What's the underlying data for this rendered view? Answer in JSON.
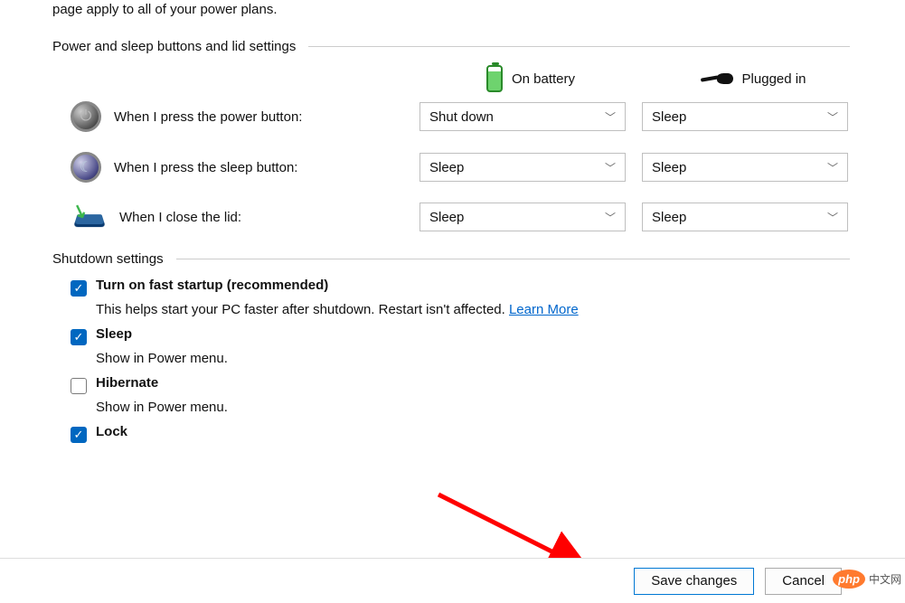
{
  "intro": "page apply to all of your power plans.",
  "sections": {
    "buttons": {
      "title": "Power and sleep buttons and lid settings",
      "columns": {
        "battery": "On battery",
        "plugged": "Plugged in"
      },
      "rows": {
        "power": {
          "label": "When I press the power button:",
          "battery": "Shut down",
          "plugged": "Sleep"
        },
        "sleep": {
          "label": "When I press the sleep button:",
          "battery": "Sleep",
          "plugged": "Sleep"
        },
        "lid": {
          "label": "When I close the lid:",
          "battery": "Sleep",
          "plugged": "Sleep"
        }
      }
    },
    "shutdown": {
      "title": "Shutdown settings",
      "items": {
        "fast": {
          "checked": true,
          "label": "Turn on fast startup (recommended)",
          "desc": "This helps start your PC faster after shutdown. Restart isn't affected.",
          "learn": "Learn More"
        },
        "sleep": {
          "checked": true,
          "label": "Sleep",
          "desc": "Show in Power menu."
        },
        "hibernate": {
          "checked": false,
          "label": "Hibernate",
          "desc": "Show in Power menu."
        },
        "lock": {
          "checked": true,
          "label": "Lock"
        }
      }
    }
  },
  "footer": {
    "save": "Save changes",
    "cancel": "Cancel"
  },
  "watermark": {
    "brand": "php",
    "text": "中文网"
  }
}
